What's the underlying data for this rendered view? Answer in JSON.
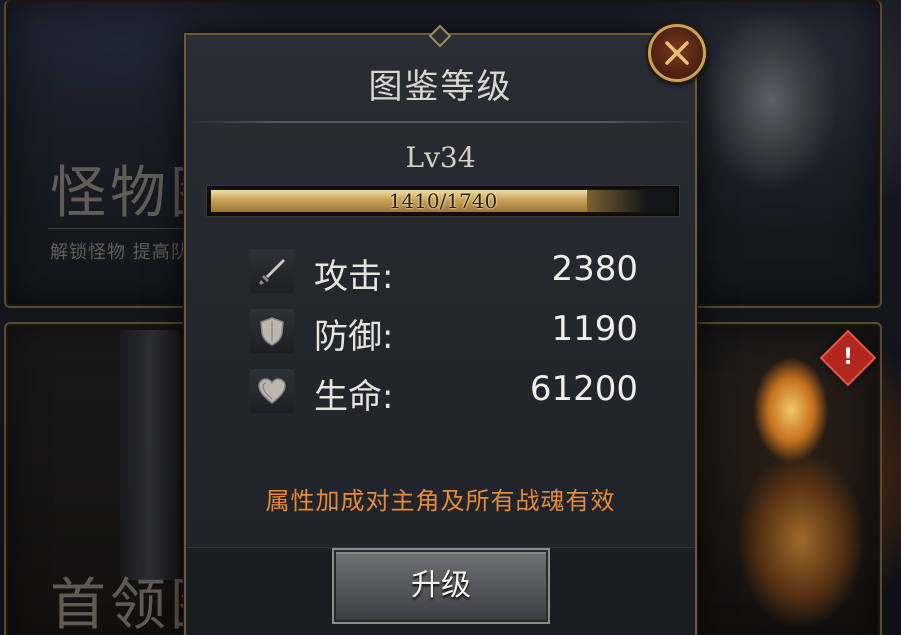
{
  "background": {
    "panel_top_title": "怪物图鉴",
    "panel_top_subtitle": "解锁怪物 提高队伍战斗",
    "panel_bottom_title": "首领图",
    "alert_icon": "exclamation-icon",
    "alert_symbol": "!"
  },
  "dialog": {
    "title": "图鉴等级",
    "level_label": "Lv34",
    "xp": {
      "current": 1410,
      "max": 1740,
      "text": "1410/1740"
    },
    "stats": [
      {
        "icon": "sword-icon",
        "label": "攻击:",
        "value": "2380"
      },
      {
        "icon": "shield-icon",
        "label": "防御:",
        "value": "1190"
      },
      {
        "icon": "heart-icon",
        "label": "生命:",
        "value": "61200"
      }
    ],
    "note": "属性加成对主角及所有战魂有效",
    "upgrade_label": "升级",
    "close_icon": "close-icon"
  },
  "colors": {
    "gold_accent": "#c9a25a",
    "note_orange": "#e58a3b",
    "dialog_bg": "#23262d",
    "alert_red": "#b3261e"
  }
}
